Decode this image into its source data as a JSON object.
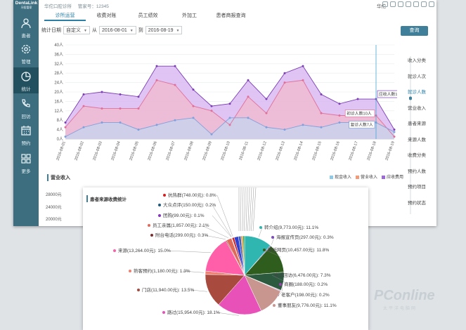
{
  "sidebar": {
    "logo_line1": "DentaLink",
    "logo_line2": "牙医管家",
    "items": [
      {
        "label": "患者",
        "icon": "person-icon"
      },
      {
        "label": "管理",
        "icon": "gear-icon"
      },
      {
        "label": "统计",
        "icon": "pie-chart-icon",
        "active": true
      },
      {
        "label": "回访",
        "icon": "phone-icon"
      },
      {
        "label": "预约",
        "icon": "calendar-icon"
      },
      {
        "label": "更多",
        "icon": "grid-icon"
      }
    ]
  },
  "header": {
    "clinic_name": "华佗口腔诊所",
    "account": "管家号：12345",
    "user": "华佗"
  },
  "tabs": [
    "诊所运营",
    "收费对账",
    "员工绩效",
    "外加工",
    "患者商报查询"
  ],
  "filters": {
    "date_label": "统计日期",
    "mode": "自定义",
    "from_label": "从",
    "from": "2016-08-01",
    "to_label": "到",
    "to": "2016-08-19",
    "query_button": "查询"
  },
  "right_nav": [
    "收入分类",
    "就诊人次",
    "就诊人数",
    "营业收入",
    "患者来源",
    "来源人数",
    "收费分类",
    "预约人数",
    "预约项目",
    "预约状态"
  ],
  "chart_data": {
    "type": "area",
    "x": [
      "2016-08-01",
      "2016-08-02",
      "2016-08-03",
      "2016-08-04",
      "2016-08-05",
      "2016-08-06",
      "2016-08-07",
      "2016-08-08",
      "2016-08-09",
      "2016-08-10",
      "2016-08-11",
      "2016-08-12",
      "2016-08-13",
      "2016-08-14",
      "2016-08-15",
      "2016-08-16",
      "2016-08-17",
      "2016-08-18",
      "2016-08-19"
    ],
    "yticks": [
      "0人",
      "4人",
      "8人",
      "12人",
      "16人",
      "20人",
      "24人",
      "28人",
      "32人",
      "36人",
      "40人"
    ],
    "ylim": [
      0,
      40
    ],
    "series": [
      {
        "name": "应收人数",
        "color": "#7b3fb3",
        "fill": "#d6b0f0",
        "values": [
          7,
          19,
          20,
          19,
          18,
          31,
          31,
          21,
          14,
          15,
          25,
          17,
          28,
          31,
          19,
          15,
          17,
          17,
          4
        ]
      },
      {
        "name": "初诊人数",
        "color": "#e0709a",
        "fill": "#f2b9cd",
        "values": [
          5,
          14,
          13,
          13,
          13,
          25,
          23,
          14,
          12,
          6,
          18,
          11,
          24,
          25,
          11,
          10,
          10,
          10,
          1
        ]
      },
      {
        "name": "复诊人数",
        "color": "#7fa0da",
        "fill": "#c5d5f0",
        "values": [
          1,
          5,
          7,
          7,
          4,
          6,
          8,
          9,
          2,
          9,
          9,
          5,
          4,
          6,
          5,
          7,
          7,
          7,
          3
        ]
      }
    ],
    "tooltips": [
      "应收人数17人",
      "初诊人数10人",
      "复诊人数7人"
    ],
    "legend": [
      "现金收入",
      "营业收入",
      "应收费用"
    ],
    "legend_colors": [
      "#8ec9e8",
      "#f29b7a",
      "#9b6ad6"
    ],
    "legend_position": "bottom-right"
  },
  "revenue": {
    "title": "营业收入",
    "yticks": [
      "28000元",
      "24000元",
      "20000元"
    ]
  },
  "pie": {
    "title": "患者来源收费统计",
    "slices": [
      {
        "label": "转介绍(9,773.00元): 11.1%",
        "value": 9773,
        "color": "#2fb6b0"
      },
      {
        "label": "海报宣传页(297.00元): 0.3%",
        "value": 297,
        "color": "#7a4db8"
      },
      {
        "label": "报纸网页(10,457.00元): 11.8%",
        "value": 10457,
        "color": "#2f5d1e"
      },
      {
        "label": "电话回访(6,476.00元): 7.3%",
        "value": 6476,
        "color": "#2b5a3f"
      },
      {
        "label": "商圈(188.00元): 0.2%",
        "value": 188,
        "color": "#a23bb6"
      },
      {
        "label": "老客户(198.00元): 0.2%",
        "value": 198,
        "color": "#5f3a7a"
      },
      {
        "label": "董事朋友(9,776.00元): 11.1%",
        "value": 9776,
        "color": "#c9958f"
      },
      {
        "label": "路过(15,954.00元): 18.1%",
        "value": 15954,
        "color": "#e852b8"
      },
      {
        "label": "门店(11,940.00元): 13.5%",
        "value": 11940,
        "color": "#a94a3f"
      },
      {
        "label": "熟客预约(1,180.00元): 1.3%",
        "value": 1180,
        "color": "#f07f6f"
      },
      {
        "label": "来源(13,264.00元): 15.0%",
        "value": 13264,
        "color": "#ff5fa9"
      },
      {
        "label": "附台电话(299.00元): 0.3%",
        "value": 299,
        "color": "#7a2e2e"
      },
      {
        "label": "员工亲属(1,857.00元): 2.1%",
        "value": 1857,
        "color": "#e06a5a"
      },
      {
        "label": "团购(99.00元): 0.1%",
        "value": 99,
        "color": "#8a30c8"
      },
      {
        "label": "大众点评(150.00元): 0.2%",
        "value": 150,
        "color": "#1e5a7a"
      },
      {
        "label": "抗热群(748.00元): 0.8%",
        "value": 748,
        "color": "#d02020"
      },
      {
        "label": "",
        "value": 1500,
        "color": "#3040d0"
      },
      {
        "label": "",
        "value": 900,
        "color": "#4060c0"
      },
      {
        "label": "",
        "value": 700,
        "color": "#e0a040"
      },
      {
        "label": "",
        "value": 600,
        "color": "#40a060"
      }
    ]
  },
  "watermark": "PConline",
  "watermark_sub": "太平洋电脑网"
}
